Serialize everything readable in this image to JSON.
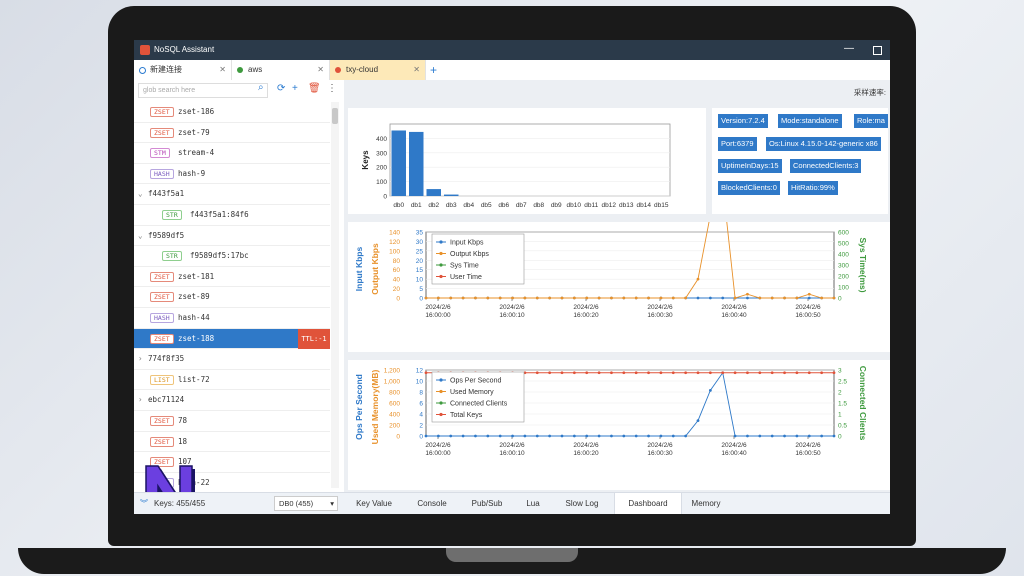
{
  "app": {
    "title": "NoSQL Assistant"
  },
  "tabs": [
    {
      "label": "新建连接",
      "color": "#2b7bd0"
    },
    {
      "label": "aws",
      "color": "#3e9a3e"
    },
    {
      "label": "txy-cloud",
      "color": "#e0533a"
    }
  ],
  "sidebar": {
    "search_placeholder": "glob search here",
    "rows": [
      {
        "kind": "key",
        "type": "ZSET",
        "name": "zset-186"
      },
      {
        "kind": "key",
        "type": "ZSET",
        "name": "zset-79"
      },
      {
        "kind": "key",
        "type": "STM",
        "name": "stream-4"
      },
      {
        "kind": "key",
        "type": "HASH",
        "name": "hash-9"
      },
      {
        "kind": "folder",
        "name": "f443f5a1",
        "open": true
      },
      {
        "kind": "key",
        "type": "STR",
        "name": "f443f5a1:84f6",
        "indent": true
      },
      {
        "kind": "folder",
        "name": "f9589df5",
        "open": true
      },
      {
        "kind": "key",
        "type": "STR",
        "name": "f9589df5:17bc",
        "indent": true
      },
      {
        "kind": "key",
        "type": "ZSET",
        "name": "zset-181"
      },
      {
        "kind": "key",
        "type": "ZSET",
        "name": "zset-89"
      },
      {
        "kind": "key",
        "type": "HASH",
        "name": "hash-44"
      },
      {
        "kind": "key",
        "type": "ZSET",
        "name": "zset-188",
        "selected": true,
        "ttl": "TTL:-1"
      },
      {
        "kind": "folder",
        "name": "774f8f35",
        "open": false
      },
      {
        "kind": "key",
        "type": "LIST",
        "name": "list-72"
      },
      {
        "kind": "folder",
        "name": "ebc71124",
        "open": false
      },
      {
        "kind": "key",
        "type": "ZSET",
        "name": "78"
      },
      {
        "kind": "key",
        "type": "ZSET",
        "name": "18"
      },
      {
        "kind": "key",
        "type": "ZSET",
        "name": "107"
      },
      {
        "kind": "key",
        "type": "HASH",
        "name": "hash-22"
      }
    ]
  },
  "status": {
    "keys": "Keys: 455/455",
    "db": "DB0 (455)",
    "tabs": [
      "Key Value",
      "Console",
      "Pub/Sub",
      "Lua",
      "Slow Log",
      "Dashboard",
      "Memory"
    ],
    "active_tab": "Dashboard"
  },
  "main": {
    "rate_label": "采样速率:",
    "info_tags": [
      "Version:7.2.4",
      "Mode:standalone",
      "Role:ma",
      "Port:6379",
      "Os:Linux 4.15.0-142-generic x86",
      "UptimeInDays:15",
      "ConnectedClients:3",
      "BlockedClients:0",
      "HitRatio:99%"
    ]
  },
  "chart_data": [
    {
      "type": "bar",
      "ylabel": "Keys",
      "categories": [
        "db0",
        "db1",
        "db2",
        "db3",
        "db4",
        "db5",
        "db6",
        "db7",
        "db8",
        "db9",
        "db10",
        "db11",
        "db12",
        "db13",
        "db14",
        "db15"
      ],
      "values": [
        455,
        445,
        48,
        10,
        0,
        0,
        0,
        0,
        0,
        0,
        0,
        0,
        0,
        0,
        0,
        0
      ],
      "ylim": [
        0,
        500
      ],
      "yticks": [
        "0",
        "100",
        "200",
        "300",
        "400"
      ],
      "color": "#2f79c8"
    },
    {
      "type": "line",
      "left_label": "Input Kbps",
      "left2_label": "Output Kbps",
      "right_label": "Sys Time(ms)",
      "x": [
        "2024/2/6 16:00:00",
        "2024/2/6 16:00:10",
        "2024/2/6 16:00:20",
        "2024/2/6 16:00:30",
        "2024/2/6 16:00:40",
        "2024/2/6 16:00:50"
      ],
      "left_ticks": [
        "0",
        "5",
        "10",
        "15",
        "20",
        "25",
        "30",
        "35"
      ],
      "left2_ticks": [
        "0",
        "20",
        "40",
        "60",
        "80",
        "100",
        "120",
        "140"
      ],
      "right_ticks": [
        "0",
        "100",
        "200",
        "300",
        "400",
        "500",
        "600"
      ],
      "series": [
        {
          "name": "Input Kbps",
          "color": "#2f79c8",
          "values": [
            0,
            0,
            0,
            0,
            0,
            0,
            0,
            0,
            0,
            0,
            0,
            0,
            0,
            0,
            0,
            0,
            0,
            0,
            0,
            0,
            0,
            0,
            0,
            0,
            0,
            0,
            0,
            0,
            0,
            0,
            0,
            0,
            0,
            0
          ]
        },
        {
          "name": "Output Kbps",
          "color": "#e8912a",
          "values": [
            0,
            0,
            0,
            0,
            0,
            0,
            0,
            0,
            0,
            0,
            0,
            0,
            0,
            0,
            0,
            0,
            0,
            0,
            0,
            0,
            0,
            0,
            10,
            44,
            60,
            0,
            2,
            0,
            0,
            0,
            0,
            2,
            0,
            0
          ]
        },
        {
          "name": "Sys Time",
          "color": "#3e9a3e",
          "values": []
        },
        {
          "name": "User Time",
          "color": "#e0533a",
          "values": [
            140,
            140,
            140,
            140,
            140,
            140,
            140,
            140,
            140,
            140,
            140,
            140,
            140,
            140,
            140,
            140,
            140,
            140,
            140,
            140,
            140,
            140,
            140,
            140,
            140,
            140,
            140,
            140,
            140,
            140,
            140,
            140,
            140,
            140
          ]
        }
      ]
    },
    {
      "type": "line",
      "left_label": "Ops Per Second",
      "left2_label": "Used Memory(MB)",
      "right_label": "Connected Clients",
      "x": [
        "2024/2/6 16:00:00",
        "2024/2/6 16:00:10",
        "2024/2/6 16:00:20",
        "2024/2/6 16:00:30",
        "2024/2/6 16:00:40",
        "2024/2/6 16:00:50"
      ],
      "left_ticks": [
        "0",
        "2",
        "4",
        "6",
        "8",
        "10",
        "12"
      ],
      "left2_ticks": [
        "0",
        "200",
        "400",
        "600",
        "800",
        "1,000",
        "1,200"
      ],
      "right_ticks": [
        "0",
        "0.5",
        "1",
        "1.5",
        "2",
        "2.5",
        "3"
      ],
      "series": [
        {
          "name": "Ops Per Second",
          "color": "#2f79c8",
          "values": [
            0,
            0,
            0,
            0,
            0,
            0,
            0,
            0,
            0,
            0,
            0,
            0,
            0,
            0,
            0,
            0,
            0,
            0,
            0,
            0,
            0,
            0,
            2.8,
            8.3,
            11.5,
            0,
            0,
            0,
            0,
            0,
            0,
            0,
            0,
            0
          ]
        },
        {
          "name": "Used Memory",
          "color": "#e8912a",
          "values": []
        },
        {
          "name": "Connected Clients",
          "color": "#3e9a3e",
          "values": []
        },
        {
          "name": "Total Keys",
          "color": "#e0533a",
          "values": [
            11.5,
            11.5,
            11.5,
            11.5,
            11.5,
            11.5,
            11.5,
            11.5,
            11.5,
            11.5,
            11.5,
            11.5,
            11.5,
            11.5,
            11.5,
            11.5,
            11.5,
            11.5,
            11.5,
            11.5,
            11.5,
            11.5,
            11.5,
            11.5,
            11.5,
            11.5,
            11.5,
            11.5,
            11.5,
            11.5,
            11.5,
            11.5,
            11.5,
            11.5
          ]
        }
      ]
    }
  ]
}
